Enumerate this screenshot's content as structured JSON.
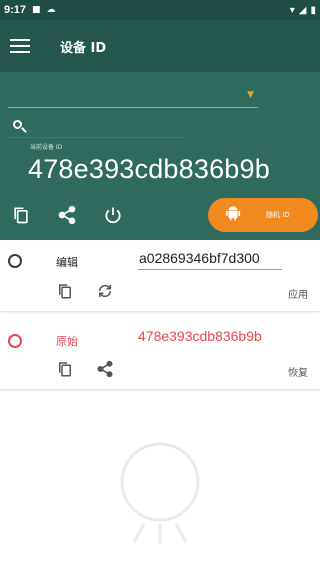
{
  "status_bar": {
    "time": "9:17"
  },
  "app_bar": {
    "title": "设备 ID",
    "menu_icon": "menu-icon"
  },
  "header": {
    "current_label": "当前设备 ID",
    "device_id": "478e393cdb836b9b",
    "random_button_label": "随机 ID",
    "icons": [
      "copy-icon",
      "share-icon",
      "power-icon",
      "android-icon"
    ],
    "accent_color": "#f08a1e",
    "background_color": "#2f6a5f"
  },
  "rows": {
    "edit": {
      "label": "编辑",
      "value": "a02869346bf7d300",
      "action": "应用",
      "icons": [
        "copy-icon",
        "refresh-icon"
      ]
    },
    "original": {
      "label": "原始",
      "value": "478e393cdb836b9b",
      "action": "恢复",
      "color": "#e8474d",
      "icons": [
        "copy-icon",
        "share-icon"
      ]
    }
  }
}
